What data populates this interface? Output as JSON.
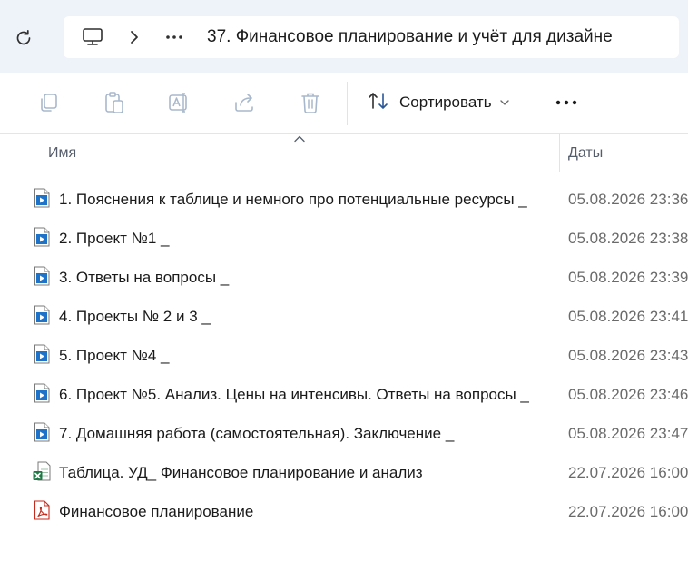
{
  "address_bar": {
    "path_item": "37. Финансовое планирование и учёт для дизайне",
    "icons": [
      "refresh-icon",
      "computer-icon",
      "chevron-right-icon",
      "more-horizontal-icon"
    ]
  },
  "toolbar": {
    "sort_label": "Сортировать",
    "buttons": [
      "copy-icon",
      "paste-icon",
      "rename-icon",
      "share-icon",
      "delete-icon"
    ],
    "disabled_color": "#a8b8cc",
    "sort_icon_color": "#2b5797"
  },
  "columns": {
    "name": "Имя",
    "date": "Даты"
  },
  "files": [
    {
      "name": "1. Пояснения к таблице и немного про потенциальные ресурсы _",
      "date": "05.08.2026 23:36",
      "type": "video"
    },
    {
      "name": "2. Проект №1 _",
      "date": "05.08.2026 23:38",
      "type": "video"
    },
    {
      "name": "3. Ответы на вопросы _",
      "date": "05.08.2026 23:39",
      "type": "video"
    },
    {
      "name": "4. Проекты № 2 и 3 _",
      "date": "05.08.2026 23:41",
      "type": "video"
    },
    {
      "name": "5. Проект №4 _",
      "date": "05.08.2026 23:43",
      "type": "video"
    },
    {
      "name": "6. Проект №5. Анализ. Цены на интенсивы. Ответы на вопросы _",
      "date": "05.08.2026 23:46",
      "type": "video"
    },
    {
      "name": "7. Домашняя работа (самостоятельная). Заключение _",
      "date": "05.08.2026 23:47",
      "type": "video"
    },
    {
      "name": "Таблица. УД_ Финансовое планирование и анализ",
      "date": "22.07.2026 16:00",
      "type": "excel"
    },
    {
      "name": "Финансовое планирование",
      "date": "22.07.2026 16:00",
      "type": "pdf"
    }
  ]
}
